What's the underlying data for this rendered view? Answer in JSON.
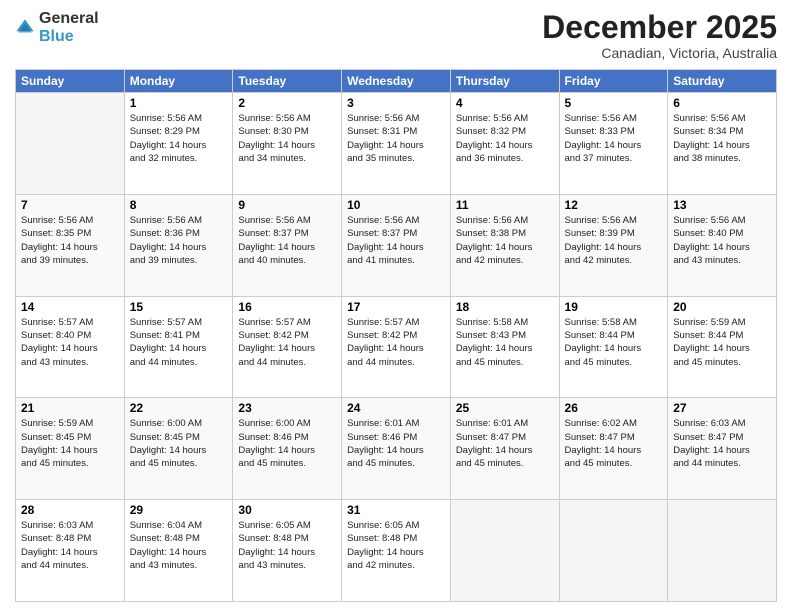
{
  "logo": {
    "general": "General",
    "blue": "Blue"
  },
  "header": {
    "month": "December 2025",
    "location": "Canadian, Victoria, Australia"
  },
  "days_of_week": [
    "Sunday",
    "Monday",
    "Tuesday",
    "Wednesday",
    "Thursday",
    "Friday",
    "Saturday"
  ],
  "weeks": [
    [
      {
        "day": "",
        "info": ""
      },
      {
        "day": "1",
        "info": "Sunrise: 5:56 AM\nSunset: 8:29 PM\nDaylight: 14 hours\nand 32 minutes."
      },
      {
        "day": "2",
        "info": "Sunrise: 5:56 AM\nSunset: 8:30 PM\nDaylight: 14 hours\nand 34 minutes."
      },
      {
        "day": "3",
        "info": "Sunrise: 5:56 AM\nSunset: 8:31 PM\nDaylight: 14 hours\nand 35 minutes."
      },
      {
        "day": "4",
        "info": "Sunrise: 5:56 AM\nSunset: 8:32 PM\nDaylight: 14 hours\nand 36 minutes."
      },
      {
        "day": "5",
        "info": "Sunrise: 5:56 AM\nSunset: 8:33 PM\nDaylight: 14 hours\nand 37 minutes."
      },
      {
        "day": "6",
        "info": "Sunrise: 5:56 AM\nSunset: 8:34 PM\nDaylight: 14 hours\nand 38 minutes."
      }
    ],
    [
      {
        "day": "7",
        "info": "Sunrise: 5:56 AM\nSunset: 8:35 PM\nDaylight: 14 hours\nand 39 minutes."
      },
      {
        "day": "8",
        "info": "Sunrise: 5:56 AM\nSunset: 8:36 PM\nDaylight: 14 hours\nand 39 minutes."
      },
      {
        "day": "9",
        "info": "Sunrise: 5:56 AM\nSunset: 8:37 PM\nDaylight: 14 hours\nand 40 minutes."
      },
      {
        "day": "10",
        "info": "Sunrise: 5:56 AM\nSunset: 8:37 PM\nDaylight: 14 hours\nand 41 minutes."
      },
      {
        "day": "11",
        "info": "Sunrise: 5:56 AM\nSunset: 8:38 PM\nDaylight: 14 hours\nand 42 minutes."
      },
      {
        "day": "12",
        "info": "Sunrise: 5:56 AM\nSunset: 8:39 PM\nDaylight: 14 hours\nand 42 minutes."
      },
      {
        "day": "13",
        "info": "Sunrise: 5:56 AM\nSunset: 8:40 PM\nDaylight: 14 hours\nand 43 minutes."
      }
    ],
    [
      {
        "day": "14",
        "info": "Sunrise: 5:57 AM\nSunset: 8:40 PM\nDaylight: 14 hours\nand 43 minutes."
      },
      {
        "day": "15",
        "info": "Sunrise: 5:57 AM\nSunset: 8:41 PM\nDaylight: 14 hours\nand 44 minutes."
      },
      {
        "day": "16",
        "info": "Sunrise: 5:57 AM\nSunset: 8:42 PM\nDaylight: 14 hours\nand 44 minutes."
      },
      {
        "day": "17",
        "info": "Sunrise: 5:57 AM\nSunset: 8:42 PM\nDaylight: 14 hours\nand 44 minutes."
      },
      {
        "day": "18",
        "info": "Sunrise: 5:58 AM\nSunset: 8:43 PM\nDaylight: 14 hours\nand 45 minutes."
      },
      {
        "day": "19",
        "info": "Sunrise: 5:58 AM\nSunset: 8:44 PM\nDaylight: 14 hours\nand 45 minutes."
      },
      {
        "day": "20",
        "info": "Sunrise: 5:59 AM\nSunset: 8:44 PM\nDaylight: 14 hours\nand 45 minutes."
      }
    ],
    [
      {
        "day": "21",
        "info": "Sunrise: 5:59 AM\nSunset: 8:45 PM\nDaylight: 14 hours\nand 45 minutes."
      },
      {
        "day": "22",
        "info": "Sunrise: 6:00 AM\nSunset: 8:45 PM\nDaylight: 14 hours\nand 45 minutes."
      },
      {
        "day": "23",
        "info": "Sunrise: 6:00 AM\nSunset: 8:46 PM\nDaylight: 14 hours\nand 45 minutes."
      },
      {
        "day": "24",
        "info": "Sunrise: 6:01 AM\nSunset: 8:46 PM\nDaylight: 14 hours\nand 45 minutes."
      },
      {
        "day": "25",
        "info": "Sunrise: 6:01 AM\nSunset: 8:47 PM\nDaylight: 14 hours\nand 45 minutes."
      },
      {
        "day": "26",
        "info": "Sunrise: 6:02 AM\nSunset: 8:47 PM\nDaylight: 14 hours\nand 45 minutes."
      },
      {
        "day": "27",
        "info": "Sunrise: 6:03 AM\nSunset: 8:47 PM\nDaylight: 14 hours\nand 44 minutes."
      }
    ],
    [
      {
        "day": "28",
        "info": "Sunrise: 6:03 AM\nSunset: 8:48 PM\nDaylight: 14 hours\nand 44 minutes."
      },
      {
        "day": "29",
        "info": "Sunrise: 6:04 AM\nSunset: 8:48 PM\nDaylight: 14 hours\nand 43 minutes."
      },
      {
        "day": "30",
        "info": "Sunrise: 6:05 AM\nSunset: 8:48 PM\nDaylight: 14 hours\nand 43 minutes."
      },
      {
        "day": "31",
        "info": "Sunrise: 6:05 AM\nSunset: 8:48 PM\nDaylight: 14 hours\nand 42 minutes."
      },
      {
        "day": "",
        "info": ""
      },
      {
        "day": "",
        "info": ""
      },
      {
        "day": "",
        "info": ""
      }
    ]
  ]
}
